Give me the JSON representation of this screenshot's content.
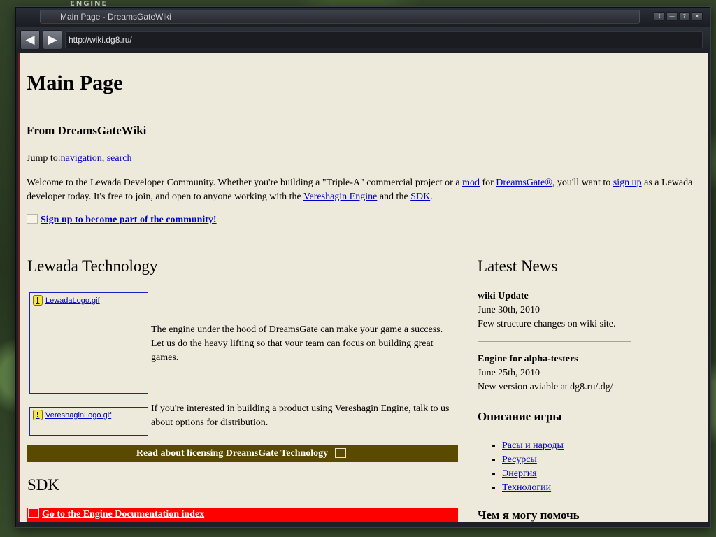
{
  "window": {
    "title": "Main Page - DreamsGateWiki",
    "controls": [
      "↕",
      "—",
      "?",
      "✕"
    ]
  },
  "backdrop": {
    "sign_text": "ENGINE"
  },
  "toolbar": {
    "back_icon": "🡐",
    "forward_icon": "🡒",
    "address": "http://wiki.dg8.ru/"
  },
  "page": {
    "title": "Main Page",
    "site_subtitle": "From DreamsGateWiki",
    "jump": {
      "prefix": "Jump to:",
      "navigation": "navigation",
      "sep": ",",
      "search": "search"
    },
    "intro": {
      "t1": "Welcome to the Lewada Developer Community. Whether you're building a \"Triple-A\" commercial project or a ",
      "mod": "mod",
      "t2": " for ",
      "dreamsgate": "DreamsGate®",
      "t3": ", you'll want to ",
      "signup": "sign up",
      "t4": " as a Lewada developer today. It's free to join, and open to anyone working with the ",
      "vereshagin": "Vereshagin Engine",
      "t5": " and the ",
      "sdk": "SDK",
      "t6": "."
    },
    "signup_link": "Sign up to become part of the community!",
    "lewada": {
      "heading": "Lewada Technology",
      "logo1": "LewadaLogo.gif",
      "text1": "The engine under the hood of DreamsGate can make your game a success. Let us do the heavy lifting so that your team can focus on building great games.",
      "logo2": "VereshaginLogo.gif",
      "text2": "If you're interested in building a product using Vereshagin Engine, talk to us about options for distribution.",
      "license_link": "Read about licensing DreamsGate Technology"
    },
    "sdk": {
      "heading": "SDK",
      "doc_link": "Go to the Engine Documentation index"
    },
    "news": {
      "heading": "Latest News",
      "items": [
        {
          "title": "wiki Update",
          "date": "June 30th, 2010",
          "text": "Few structure changes on wiki site."
        },
        {
          "title": "Engine for alpha-testers",
          "date": "June 25th, 2010",
          "text": "New version aviable at dg8.ru/.dg/"
        }
      ]
    },
    "game": {
      "heading": "Описание игры",
      "links": [
        "Расы и народы",
        "Ресурсы",
        "Энергия",
        "Технологии"
      ]
    },
    "help": {
      "heading": "Чем я могу помочь"
    }
  },
  "colors": {
    "page_bg": "#eeeadb",
    "link": "#0000cc",
    "license_bar": "#5a4a00",
    "doc_bar": "#ff0000"
  }
}
